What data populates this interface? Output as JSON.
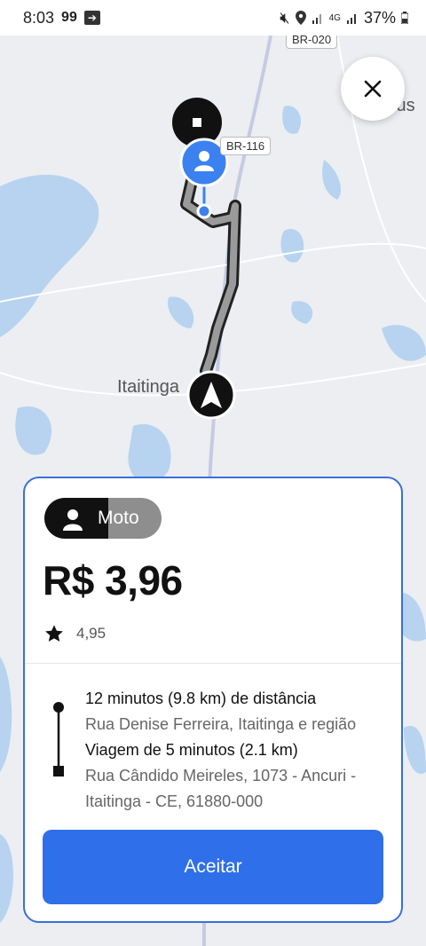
{
  "status_bar": {
    "time": "8:03",
    "app_badge": "99",
    "battery": "37%"
  },
  "map": {
    "city_label": "Itaitinga",
    "road_label": "BR-116",
    "road_label_top": "BR-020",
    "edge_label": "lus"
  },
  "offer": {
    "service": "Moto",
    "price": "R$ 3,96",
    "rating": "4,95",
    "pickup_distance": "12 minutos (9.8 km) de distância",
    "pickup_address": "Rua Denise Ferreira, Itaitinga e região",
    "trip_duration": "Viagem de 5 minutos (2.1 km)",
    "dropoff_address": "Rua Cândido Meireles, 1073 - Ancuri - Itaitinga - CE, 61880-000",
    "accept_label": "Aceitar"
  },
  "colors": {
    "accent": "#2f6fea",
    "card_border": "#3b6fd8",
    "marker_blue": "#3b82f0"
  }
}
